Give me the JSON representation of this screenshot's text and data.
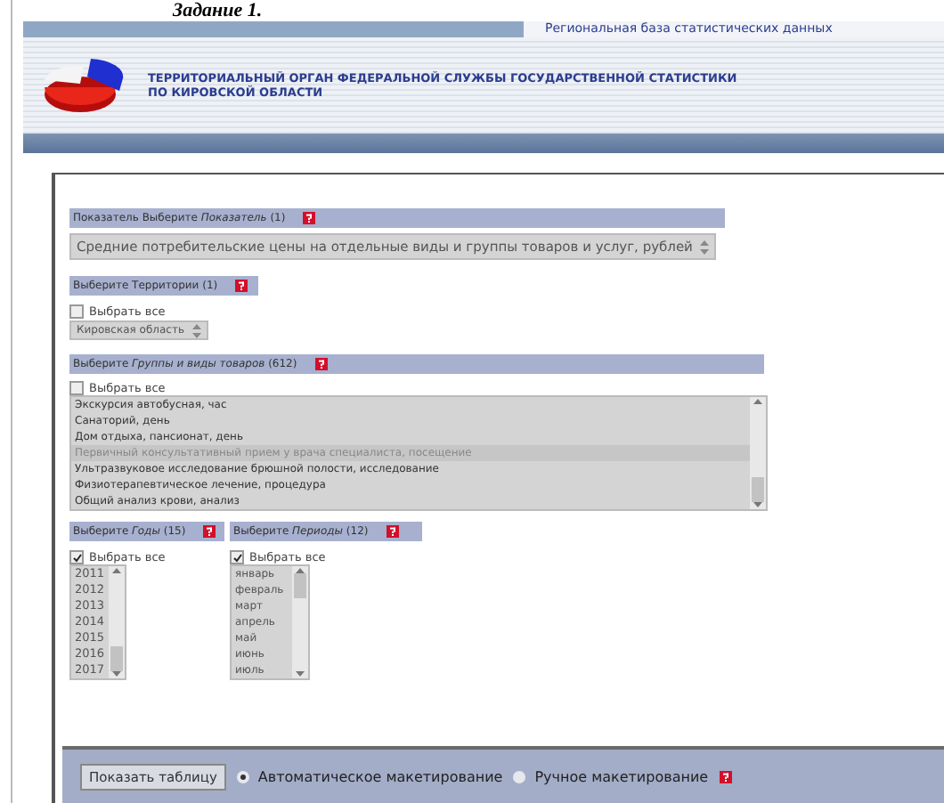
{
  "title": "Задание 1.",
  "header": {
    "site_name": "Региональная база статистических данных",
    "org_line_1": "ТЕРРИТОРИАЛЬНЫЙ ОРГАН ФЕДЕРАЛЬНОЙ СЛУЖБЫ ГОСУДАРСТВЕННОЙ СТАТИСТИКИ",
    "org_line_2": "ПО КИРОВСКОЙ ОБЛАСТИ"
  },
  "indicator": {
    "heading": "Показатель Выберите *Показатель* (1)",
    "value": "Средние потребительские цены на отдельные виды и группы товаров и услуг, рублей"
  },
  "territory": {
    "heading": "Выберите Территории (1)",
    "select_all": {
      "label": "Выбрать все",
      "checked": false
    },
    "value": "Кировская область"
  },
  "goods": {
    "heading": "Выберите *Группы и виды товаров* (612)",
    "select_all": {
      "label": "Выбрать все",
      "checked": false
    },
    "items": [
      {
        "label": "Экскурсия автобусная, час",
        "selected": false
      },
      {
        "label": "Санаторий, день",
        "selected": false
      },
      {
        "label": "Дом отдыха, пансионат, день",
        "selected": false
      },
      {
        "label": "Первичный консультативный прием у врача специалиста, посещение",
        "selected": true
      },
      {
        "label": "Ультразвуковое исследование брюшной полости, исследование",
        "selected": false
      },
      {
        "label": "Физиотерапевтическое лечение, процедура",
        "selected": false
      },
      {
        "label": "Общий анализ крови, анализ",
        "selected": false
      }
    ]
  },
  "years": {
    "heading": "Выберите *Годы* (15)",
    "select_all": {
      "label": "Выбрать все",
      "checked": true
    },
    "items": [
      {
        "label": "2011",
        "selected": true
      },
      {
        "label": "2012",
        "selected": true
      },
      {
        "label": "2013",
        "selected": true
      },
      {
        "label": "2014",
        "selected": true
      },
      {
        "label": "2015",
        "selected": true
      },
      {
        "label": "2016",
        "selected": true
      },
      {
        "label": "2017",
        "selected": true
      }
    ]
  },
  "periods": {
    "heading": "Выберите *Периоды* (12)",
    "select_all": {
      "label": "Выбрать все",
      "checked": true
    },
    "items": [
      {
        "label": "январь",
        "selected": true
      },
      {
        "label": "февраль",
        "selected": true
      },
      {
        "label": "март",
        "selected": true
      },
      {
        "label": "апрель",
        "selected": true
      },
      {
        "label": "май",
        "selected": true
      },
      {
        "label": "июнь",
        "selected": true
      },
      {
        "label": "июль",
        "selected": true
      }
    ]
  },
  "footer": {
    "button": "Показать таблицу",
    "modes": [
      {
        "label": "Автоматическое макетирование",
        "selected": true
      },
      {
        "label": "Ручное макетирование",
        "selected": false
      }
    ]
  }
}
